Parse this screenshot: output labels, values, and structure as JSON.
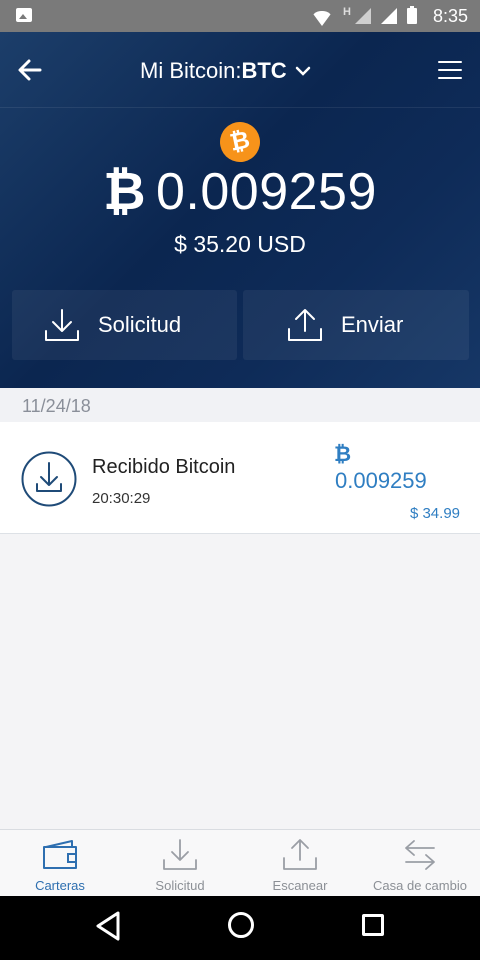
{
  "status_bar": {
    "network_type": "H",
    "time": "8:35"
  },
  "header": {
    "title_prefix": "Mi Bitcoin:",
    "title_currency": "BTC",
    "coin_symbol": "₿"
  },
  "wallet": {
    "balance_symbol": "₿",
    "balance": "0.009259",
    "fiat_balance": "$ 35.20 USD"
  },
  "actions": {
    "request_label": "Solicitud",
    "send_label": "Enviar"
  },
  "transactions": [
    {
      "date": "11/24/18",
      "title": "Recibido Bitcoin",
      "time": "20:30:29",
      "amount_symbol": "₿",
      "amount": "0.009259",
      "fiat": "$ 34.99"
    }
  ],
  "bottom_nav": [
    {
      "label": "Carteras",
      "icon": "wallet-icon",
      "active": true
    },
    {
      "label": "Solicitud",
      "icon": "download-icon",
      "active": false
    },
    {
      "label": "Escanear",
      "icon": "upload-icon",
      "active": false
    },
    {
      "label": "Casa de cambio",
      "icon": "exchange-icon",
      "active": false
    }
  ],
  "colors": {
    "header_bg": "#0b2650",
    "bitcoin_orange": "#f7931a",
    "accent_blue": "#2f7ec2",
    "nav_active": "#2e6fb0"
  }
}
